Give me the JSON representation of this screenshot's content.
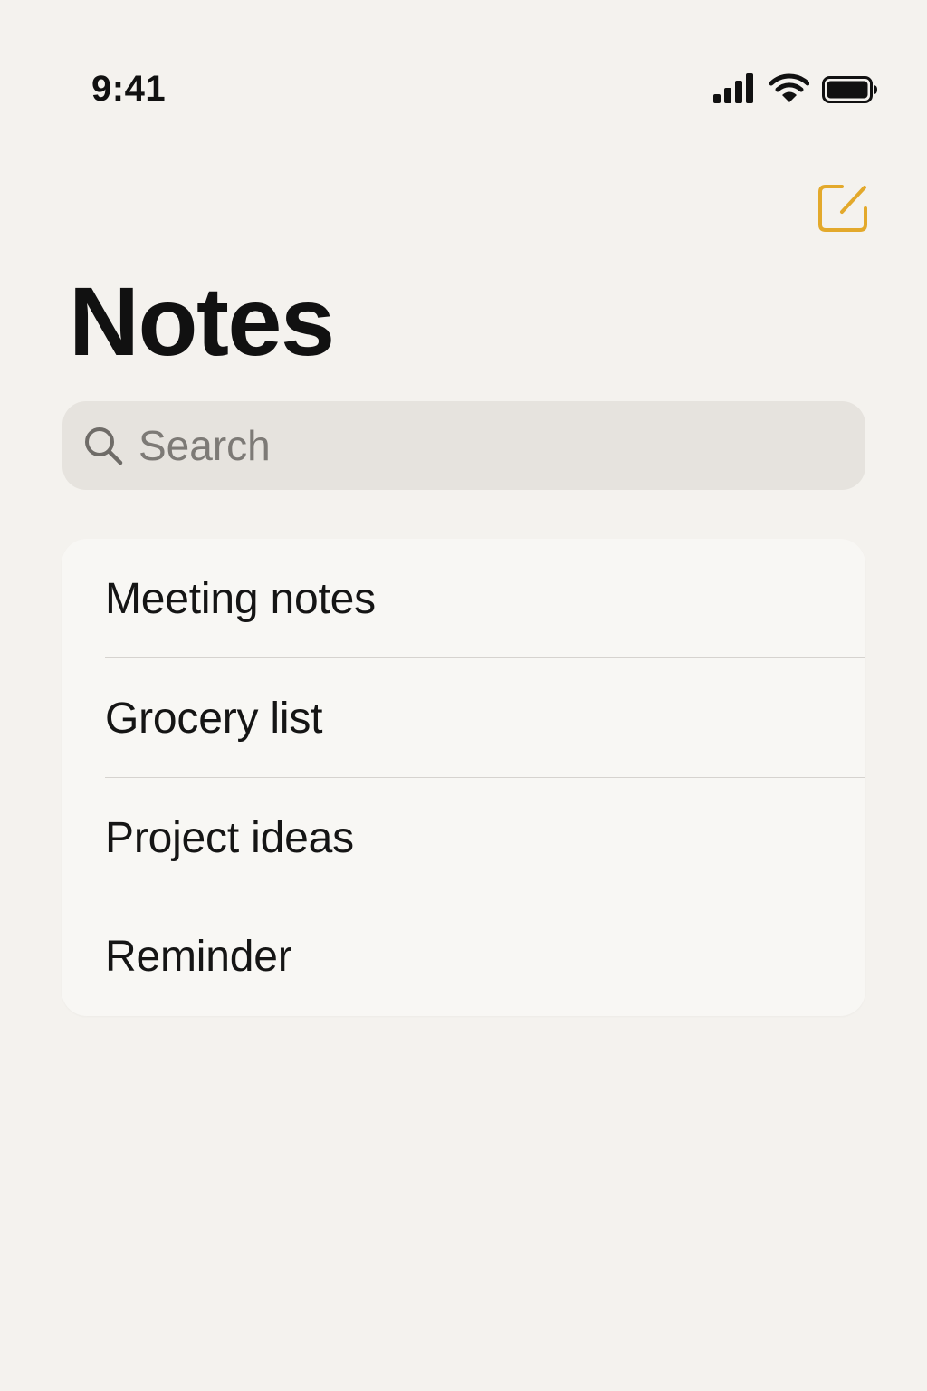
{
  "status_bar": {
    "time": "9:41",
    "icons": [
      "cellular-signal-icon",
      "wifi-icon",
      "battery-icon"
    ]
  },
  "header": {
    "compose_icon": "compose-icon",
    "title": "Notes"
  },
  "search": {
    "placeholder": "Search",
    "value": "",
    "icon": "search-icon"
  },
  "notes": [
    {
      "title": "Meeting notes"
    },
    {
      "title": "Grocery list"
    },
    {
      "title": "Project ideas"
    },
    {
      "title": "Reminder"
    }
  ],
  "colors": {
    "background": "#f4f2ee",
    "accent": "#e3a92b",
    "search_background": "#e6e3de",
    "list_background": "#f8f7f4",
    "text": "#111111",
    "placeholder": "#7d7a76"
  }
}
